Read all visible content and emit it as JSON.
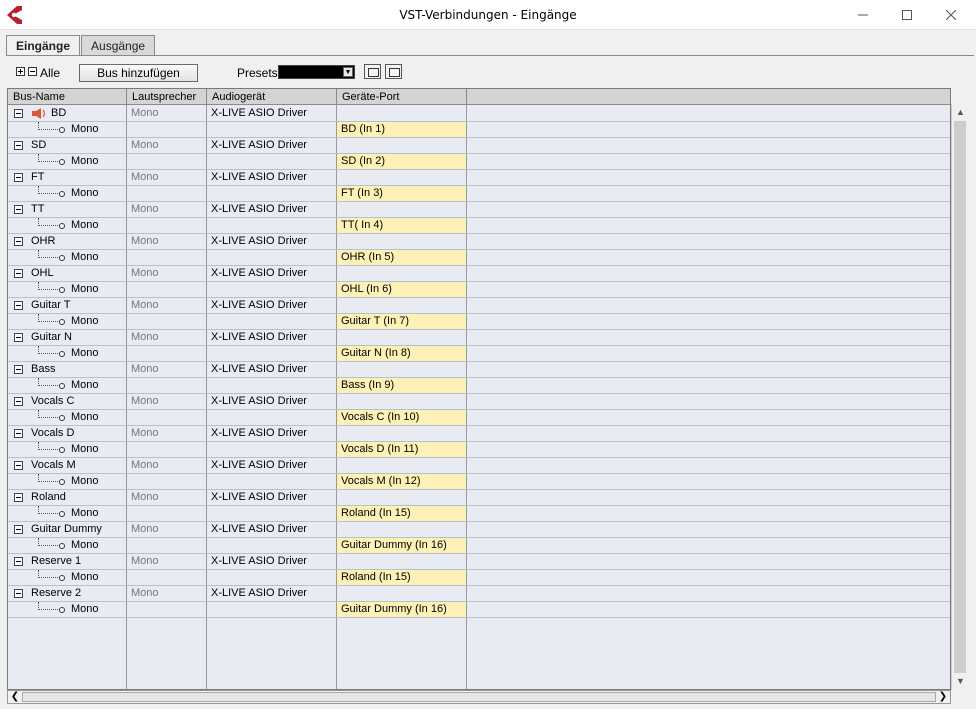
{
  "window": {
    "title": "VST-Verbindungen - Eingänge"
  },
  "tabs": [
    {
      "label": "Eingänge",
      "active": true
    },
    {
      "label": "Ausgänge",
      "active": false
    }
  ],
  "toolbar": {
    "alle_label": "Alle",
    "add_bus_label": "Bus hinzufügen",
    "presets_label": "Presets",
    "presets_value": ""
  },
  "columns": {
    "bus_name": "Bus-Name",
    "speaker": "Lautsprecher",
    "device": "Audiogerät",
    "port": "Geräte-Port"
  },
  "buses": [
    {
      "name": "BD",
      "speaker": "Mono",
      "device": "X-LIVE ASIO Driver",
      "channel": "Mono",
      "port": "BD (In 1)",
      "icon": "speaker-icon"
    },
    {
      "name": "SD",
      "speaker": "Mono",
      "device": "X-LIVE ASIO Driver",
      "channel": "Mono",
      "port": "SD (In 2)"
    },
    {
      "name": "FT",
      "speaker": "Mono",
      "device": "X-LIVE ASIO Driver",
      "channel": "Mono",
      "port": "FT (In 3)"
    },
    {
      "name": "TT",
      "speaker": "Mono",
      "device": "X-LIVE ASIO Driver",
      "channel": "Mono",
      "port": "TT( In 4)"
    },
    {
      "name": "OHR",
      "speaker": "Mono",
      "device": "X-LIVE ASIO Driver",
      "channel": "Mono",
      "port": "OHR (In 5)"
    },
    {
      "name": "OHL",
      "speaker": "Mono",
      "device": "X-LIVE ASIO Driver",
      "channel": "Mono",
      "port": "OHL (In 6)"
    },
    {
      "name": "Guitar T",
      "speaker": "Mono",
      "device": "X-LIVE ASIO Driver",
      "channel": "Mono",
      "port": "Guitar T (In 7)"
    },
    {
      "name": "Guitar N",
      "speaker": "Mono",
      "device": "X-LIVE ASIO Driver",
      "channel": "Mono",
      "port": "Guitar N (In 8)"
    },
    {
      "name": "Bass",
      "speaker": "Mono",
      "device": "X-LIVE ASIO Driver",
      "channel": "Mono",
      "port": "Bass (In 9)"
    },
    {
      "name": "Vocals C",
      "speaker": "Mono",
      "device": "X-LIVE ASIO Driver",
      "channel": "Mono",
      "port": "Vocals C (In 10)"
    },
    {
      "name": "Vocals D",
      "speaker": "Mono",
      "device": "X-LIVE ASIO Driver",
      "channel": "Mono",
      "port": "Vocals D (In 11)"
    },
    {
      "name": "Vocals M",
      "speaker": "Mono",
      "device": "X-LIVE ASIO Driver",
      "channel": "Mono",
      "port": "Vocals M (In 12)"
    },
    {
      "name": "Roland",
      "speaker": "Mono",
      "device": "X-LIVE ASIO Driver",
      "channel": "Mono",
      "port": "Roland (In 15)"
    },
    {
      "name": "Guitar Dummy",
      "speaker": "Mono",
      "device": "X-LIVE ASIO Driver",
      "channel": "Mono",
      "port": "Guitar Dummy (In 16)"
    },
    {
      "name": "Reserve 1",
      "speaker": "Mono",
      "device": "X-LIVE ASIO Driver",
      "channel": "Mono",
      "port": "Roland (In 15)"
    },
    {
      "name": "Reserve 2",
      "speaker": "Mono",
      "device": "X-LIVE ASIO Driver",
      "channel": "Mono",
      "port": "Guitar Dummy (In 16)"
    }
  ],
  "colors": {
    "port_highlight": "#fdf1b8",
    "table_bg": "#e8ecf2",
    "app_icon": "#b8202c"
  }
}
